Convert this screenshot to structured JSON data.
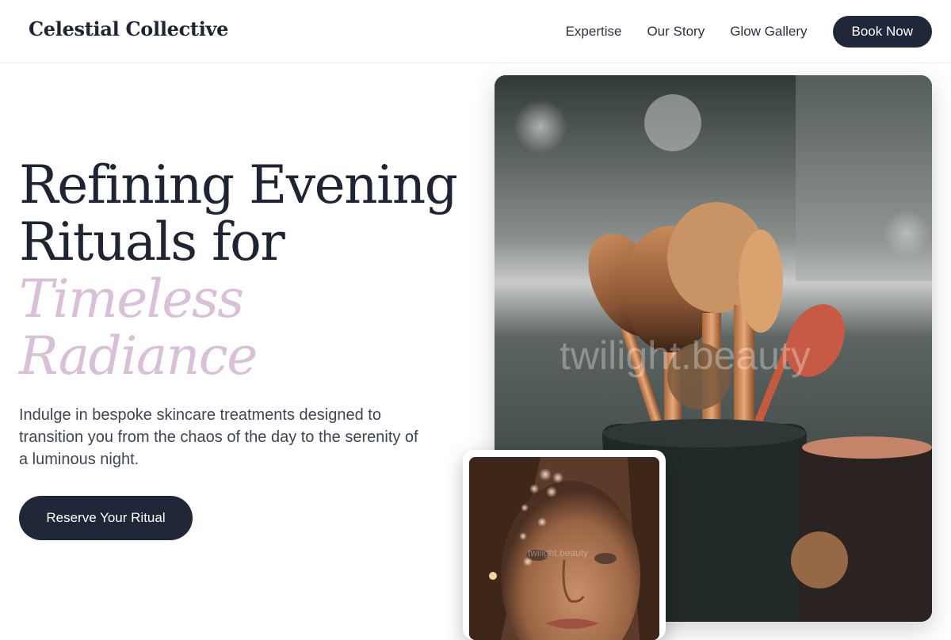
{
  "header": {
    "brand": "Celestial Collective",
    "nav": [
      "Expertise",
      "Our Story",
      "Glow Gallery"
    ],
    "book_label": "Book Now"
  },
  "hero": {
    "title_line1": "Refining Evening",
    "title_line2": "Rituals for",
    "title_accent1": "Timeless",
    "title_accent2": "Radiance",
    "description": "Indulge in bespoke skincare treatments designed to transition you from the chaos of the day to the serenity of a luminous night.",
    "cta_label": "Reserve Your Ritual"
  },
  "images": {
    "main_watermark": "twilight.beauty",
    "small_watermark": "twilight.beauty"
  },
  "colors": {
    "primary": "#1f2738",
    "accent": "#d9bfd8",
    "text": "#1e2433"
  }
}
